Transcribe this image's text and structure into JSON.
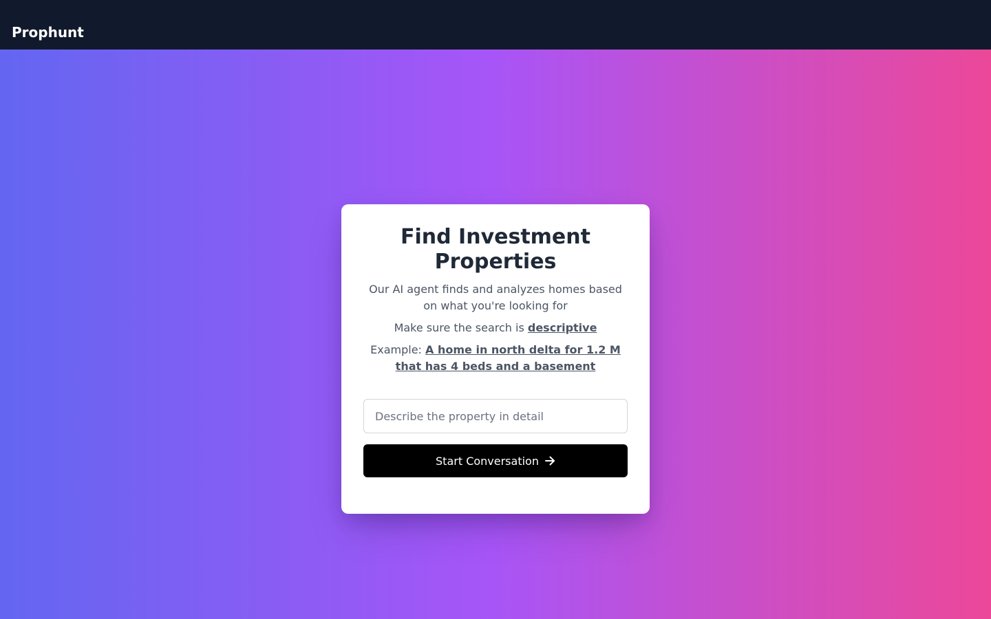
{
  "navbar": {
    "brand": "Prophunt"
  },
  "card": {
    "title": "Find Investment Properties",
    "subtitle": "Our AI agent finds and analyzes homes based on what you're looking for",
    "hint_prefix": "Make sure the search is ",
    "hint_emphasis": "descriptive",
    "example_prefix": "Example: ",
    "example_text": "A home in north delta for 1.2 M that has 4 beds and a basement",
    "input": {
      "value": "",
      "placeholder": "Describe the property in detail"
    },
    "button_label": "Start Conversation",
    "button_icon": "arrow-right-icon"
  },
  "colors": {
    "navbar_bg": "#111a2c",
    "gradient_start": "#6366f1",
    "gradient_mid": "#a855f7",
    "gradient_end": "#ec4899",
    "button_bg": "#000000"
  }
}
